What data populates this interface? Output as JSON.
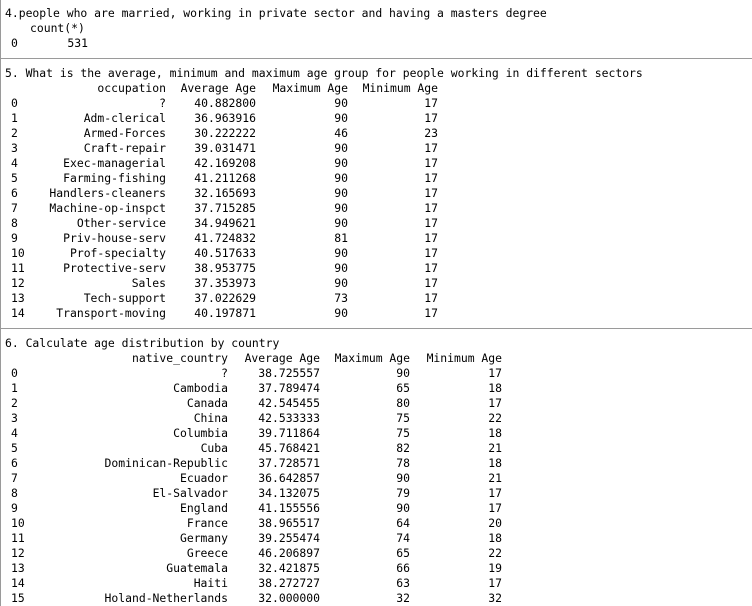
{
  "section4": {
    "title": "4.people who are married, working in private sector and having a masters degree",
    "header": "count(*)",
    "rows": [
      {
        "idx": "0",
        "value": "531"
      }
    ]
  },
  "section5": {
    "title": "5. What is the average, minimum and maximum age group for people working in different sectors",
    "headers": [
      "occupation",
      "Average Age",
      "Maximum Age",
      "Minimum Age"
    ],
    "rows": [
      {
        "idx": "0",
        "name": "?",
        "avg": "40.882800",
        "max": "90",
        "min": "17"
      },
      {
        "idx": "1",
        "name": "Adm-clerical",
        "avg": "36.963916",
        "max": "90",
        "min": "17"
      },
      {
        "idx": "2",
        "name": "Armed-Forces",
        "avg": "30.222222",
        "max": "46",
        "min": "23"
      },
      {
        "idx": "3",
        "name": "Craft-repair",
        "avg": "39.031471",
        "max": "90",
        "min": "17"
      },
      {
        "idx": "4",
        "name": "Exec-managerial",
        "avg": "42.169208",
        "max": "90",
        "min": "17"
      },
      {
        "idx": "5",
        "name": "Farming-fishing",
        "avg": "41.211268",
        "max": "90",
        "min": "17"
      },
      {
        "idx": "6",
        "name": "Handlers-cleaners",
        "avg": "32.165693",
        "max": "90",
        "min": "17"
      },
      {
        "idx": "7",
        "name": "Machine-op-inspct",
        "avg": "37.715285",
        "max": "90",
        "min": "17"
      },
      {
        "idx": "8",
        "name": "Other-service",
        "avg": "34.949621",
        "max": "90",
        "min": "17"
      },
      {
        "idx": "9",
        "name": "Priv-house-serv",
        "avg": "41.724832",
        "max": "81",
        "min": "17"
      },
      {
        "idx": "10",
        "name": "Prof-specialty",
        "avg": "40.517633",
        "max": "90",
        "min": "17"
      },
      {
        "idx": "11",
        "name": "Protective-serv",
        "avg": "38.953775",
        "max": "90",
        "min": "17"
      },
      {
        "idx": "12",
        "name": "Sales",
        "avg": "37.353973",
        "max": "90",
        "min": "17"
      },
      {
        "idx": "13",
        "name": "Tech-support",
        "avg": "37.022629",
        "max": "73",
        "min": "17"
      },
      {
        "idx": "14",
        "name": "Transport-moving",
        "avg": "40.197871",
        "max": "90",
        "min": "17"
      }
    ]
  },
  "section6": {
    "title": "6. Calculate age distribution by country",
    "headers": [
      "native_country",
      "Average Age",
      "Maximum Age",
      "Minimum Age"
    ],
    "rows": [
      {
        "idx": "0",
        "name": "?",
        "avg": "38.725557",
        "max": "90",
        "min": "17"
      },
      {
        "idx": "1",
        "name": "Cambodia",
        "avg": "37.789474",
        "max": "65",
        "min": "18"
      },
      {
        "idx": "2",
        "name": "Canada",
        "avg": "42.545455",
        "max": "80",
        "min": "17"
      },
      {
        "idx": "3",
        "name": "China",
        "avg": "42.533333",
        "max": "75",
        "min": "22"
      },
      {
        "idx": "4",
        "name": "Columbia",
        "avg": "39.711864",
        "max": "75",
        "min": "18"
      },
      {
        "idx": "5",
        "name": "Cuba",
        "avg": "45.768421",
        "max": "82",
        "min": "21"
      },
      {
        "idx": "6",
        "name": "Dominican-Republic",
        "avg": "37.728571",
        "max": "78",
        "min": "18"
      },
      {
        "idx": "7",
        "name": "Ecuador",
        "avg": "36.642857",
        "max": "90",
        "min": "21"
      },
      {
        "idx": "8",
        "name": "El-Salvador",
        "avg": "34.132075",
        "max": "79",
        "min": "17"
      },
      {
        "idx": "9",
        "name": "England",
        "avg": "41.155556",
        "max": "90",
        "min": "17"
      },
      {
        "idx": "10",
        "name": "France",
        "avg": "38.965517",
        "max": "64",
        "min": "20"
      },
      {
        "idx": "11",
        "name": "Germany",
        "avg": "39.255474",
        "max": "74",
        "min": "18"
      },
      {
        "idx": "12",
        "name": "Greece",
        "avg": "46.206897",
        "max": "65",
        "min": "22"
      },
      {
        "idx": "13",
        "name": "Guatemala",
        "avg": "32.421875",
        "max": "66",
        "min": "19"
      },
      {
        "idx": "14",
        "name": "Haiti",
        "avg": "38.272727",
        "max": "63",
        "min": "17"
      },
      {
        "idx": "15",
        "name": "Holand-Netherlands",
        "avg": "32.000000",
        "max": "32",
        "min": "32"
      }
    ]
  }
}
